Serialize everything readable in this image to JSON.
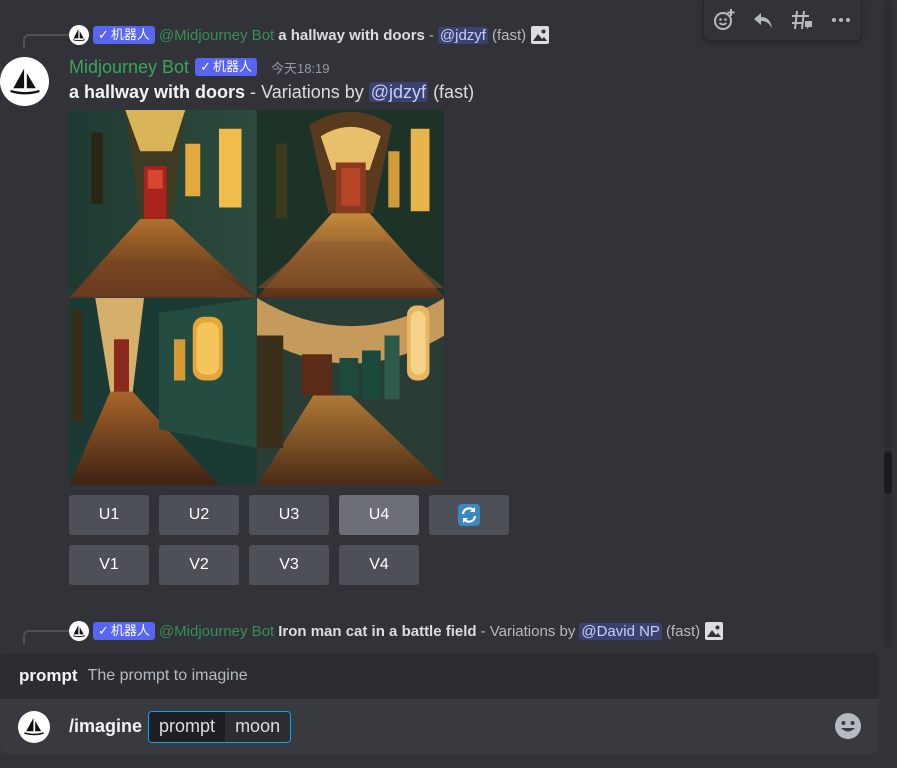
{
  "toolbar": {
    "add_reaction": "add-reaction-icon",
    "reply": "reply-icon",
    "create_thread": "thread-icon",
    "more": "more-icon"
  },
  "message1": {
    "reply": {
      "bot_tag": "机器人",
      "author": "@Midjourney Bot",
      "prompt": "a hallway with doors",
      "separator": " - ",
      "mention": "@jdzyf",
      "mode": "(fast)"
    },
    "author": "Midjourney Bot",
    "bot_tag": "机器人",
    "timestamp": "今天18:19",
    "content": {
      "prompt": "a hallway with doors",
      "variations": " - Variations by ",
      "mention": "@jdzyf",
      "mode": " (fast)"
    },
    "upscale_buttons": [
      "U1",
      "U2",
      "U3",
      "U4"
    ],
    "variation_buttons": [
      "V1",
      "V2",
      "V3",
      "V4"
    ]
  },
  "message2": {
    "reply": {
      "bot_tag": "机器人",
      "author": "@Midjourney Bot",
      "prompt": "Iron man cat in a battle field",
      "variations": " - Variations by ",
      "mention": "@David NP",
      "mode": "(fast)"
    }
  },
  "autocomplete": {
    "option_name": "prompt",
    "option_description": "The prompt to imagine"
  },
  "input": {
    "command": "/imagine",
    "option_name": "prompt",
    "option_value": "moon"
  },
  "colors": {
    "background": "#313338",
    "bot_tag": "#5865f2",
    "author": "#3ba55d",
    "button": "#4e5058",
    "mention": "#3c4270",
    "input_focus": "#00a8fc"
  }
}
